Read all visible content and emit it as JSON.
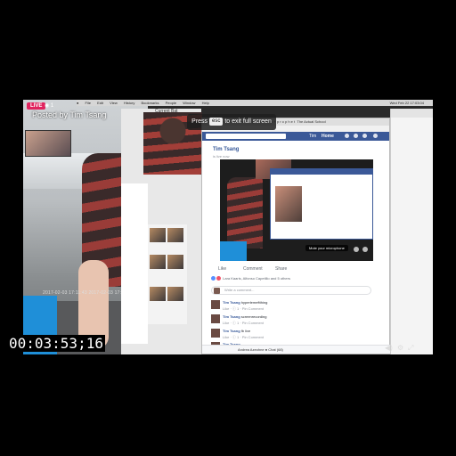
{
  "live": {
    "badge": "LIVE",
    "viewers": "◉ 1",
    "posted_by": "Posted by Tim Tsang",
    "cam_timestamp": "2017-02-03 17:11:43 2017-02-03 17:11:43"
  },
  "menubar": {
    "items": [
      "",
      "File",
      "Edit",
      "View",
      "History",
      "Bookmarks",
      "People",
      "Window",
      "Help"
    ],
    "clock": "Wed Feb 22 17:03:04"
  },
  "mid": {
    "current_label": "Current Bat"
  },
  "browser": {
    "tab_text": "Simplenote   Rare Ashes Twin ge...   m o n k + p r o p h e t   The Actual School",
    "bookmarks": [
      "Simplenote",
      "Rare Ashes Twin ge...",
      "m o n k + p r o p h e t",
      "The Actual School"
    ],
    "fb_name": "Tim",
    "fb_home": "Home",
    "post_author": "Tim Tsang",
    "post_sub": "is live now",
    "mute_label": "Mute your microphone",
    "actions": {
      "like": "Like",
      "comment": "Comment",
      "share": "Share"
    },
    "reactions": "Lara Kaaris, Alfonso Capetillo and 5 others",
    "comment_placeholder": "Write a comment...",
    "comments": [
      {
        "who": "Tim Tsang",
        "text": "hyperlemeftthing",
        "meta": "Like · ⓘ 1 · Pin Comment"
      },
      {
        "who": "Tim Tsang",
        "text": "screenrecording",
        "meta": "Like · ⓘ 1 · Pin Comment"
      },
      {
        "who": "Tim Tsang",
        "text": "fb live",
        "meta": "Like · ⓘ 1 · Pin Comment"
      },
      {
        "who": "Tim Tsang",
        "text": "",
        "meta": ""
      }
    ],
    "chat_bar": "Andrea Azeohne   ● Chat (68)"
  },
  "toast": {
    "prefix": "Press",
    "key": "esc",
    "suffix": "to exit full screen"
  },
  "timecode": "00:03:53;16",
  "colors": {
    "facebook_blue": "#3b5998",
    "live_red": "#e0245e",
    "accent_blue": "#1f8fd8"
  }
}
